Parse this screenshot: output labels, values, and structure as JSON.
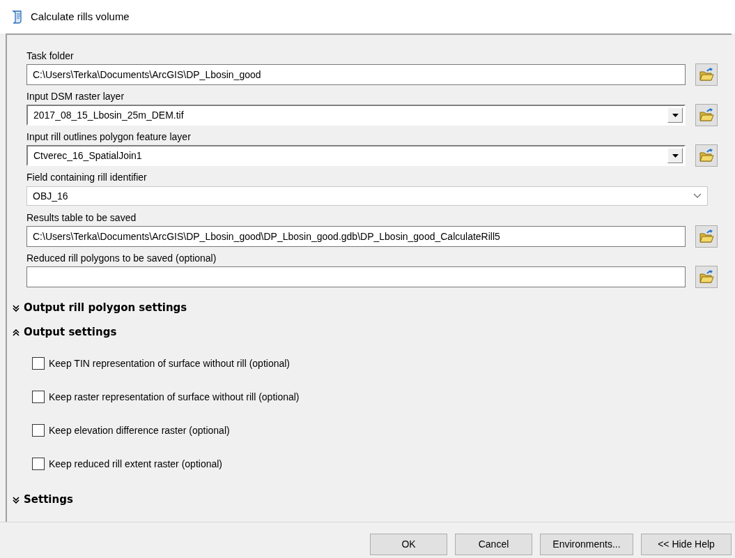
{
  "window": {
    "title": "Calculate rills volume"
  },
  "parameters": [
    {
      "label": "Task folder",
      "kind": "text",
      "value": "C:\\Users\\Terka\\Documents\\ArcGIS\\DP_Lbosin_good",
      "browse": true
    },
    {
      "label": "Input DSM raster layer",
      "kind": "combo",
      "value": "2017_08_15_Lbosin_25m_DEM.tif",
      "browse": true
    },
    {
      "label": "Input rill outlines polygon feature layer",
      "kind": "combo",
      "value": "Ctverec_16_SpatialJoin1",
      "browse": true
    },
    {
      "label": "Field containing rill identifier",
      "kind": "select",
      "value": "OBJ_16",
      "browse": false
    },
    {
      "label": "Results table to be saved",
      "kind": "text",
      "value": "C:\\Users\\Terka\\Documents\\ArcGIS\\DP_Lbosin_good\\DP_Lbosin_good.gdb\\DP_Lbosin_good_CalculateRill5",
      "browse": true
    },
    {
      "label": "Reduced rill polygons to be saved (optional)",
      "kind": "text",
      "browse": true
    }
  ],
  "sections": [
    {
      "title": "Output rill polygon settings",
      "expanded": false
    },
    {
      "title": "Output settings",
      "expanded": true,
      "options": [
        {
          "label": "Keep TIN representation of surface without rill (optional)",
          "checked": false
        },
        {
          "label": "Keep raster representation of surface without rill (optional)",
          "checked": false
        },
        {
          "label": "Keep elevation difference raster (optional)",
          "checked": false
        },
        {
          "label": "Keep reduced rill extent raster (optional)",
          "checked": false
        }
      ]
    },
    {
      "title": "Settings",
      "expanded": false
    }
  ],
  "buttons": [
    "OK",
    "Cancel",
    "Environments...",
    "<< Hide Help"
  ]
}
